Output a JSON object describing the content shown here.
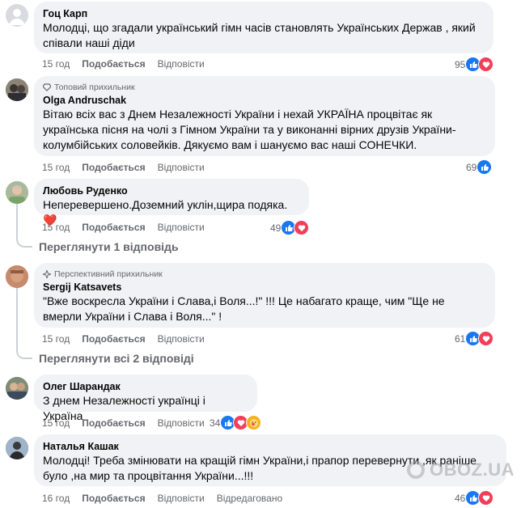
{
  "comments": [
    {
      "author": "Гоц Карп",
      "badge": "",
      "text": "Молодці, що згадали український гімн часів становлять Українських Держав , який співали наші діди",
      "time": "15 год",
      "like_label": "Подобається",
      "reply_label": "Відповісти",
      "edited": "",
      "reactions_count": "95",
      "reactions": [
        "like-icon",
        "love-icon"
      ]
    },
    {
      "author": "Olga Andruschak",
      "badge": "Топовий прихильник",
      "text": "Вітаю всіх вас з Днем Незалежності України і нехай УКРАЇНА процвітає як українська пісня на чолі з Гімном України та у виконанні вірних друзів України-колумбійських соловейків. Дякуємо вам і шануємо вас наші СОНЕЧКИ.",
      "time": "15 год",
      "like_label": "Подобається",
      "reply_label": "Відповісти",
      "edited": "",
      "reactions_count": "69",
      "reactions": [
        "like-icon"
      ]
    },
    {
      "author": "Любовь Руденко",
      "badge": "",
      "text": "Неперевершено.Доземний уклін,щира подяка.❤️",
      "time": "15 год",
      "like_label": "Подобається",
      "reply_label": "Відповісти",
      "edited": "",
      "reactions_count": "49",
      "reactions": [
        "like-icon",
        "love-icon"
      ],
      "view_replies": "Переглянути 1 відповідь"
    },
    {
      "author": "Sergij Katsavets",
      "badge": "Перспективний прихильник",
      "text": "\"Вже воскресла України і Слава,і Воля...!\" !!! Це набагато краще, чим \"Ще не вмерли України і Слава і Воля...\" !",
      "time": "15 год",
      "like_label": "Подобається",
      "reply_label": "Відповісти",
      "edited": "",
      "reactions_count": "61",
      "reactions": [
        "like-icon",
        "love-icon"
      ],
      "view_replies": "Переглянути всі 2 відповіді"
    },
    {
      "author": "Олег Шарандак",
      "badge": "",
      "text": "З днем Незалежності українці і Україна",
      "time": "15 год",
      "like_label": "Подобається",
      "reply_label": "Відповісти",
      "edited": "",
      "reactions_count": "34",
      "reactions": [
        "like-icon",
        "love-icon",
        "care-icon"
      ]
    },
    {
      "author": "Наталья Кашак",
      "badge": "",
      "text": "Молодці! Треба змінювати на кращій гімн України,і прапор перевернути ,як раніше було ,на мир та процвітання України...!!!",
      "time": "16 год",
      "like_label": "Подобається",
      "reply_label": "Відповісти",
      "edited": "Відредаговано",
      "reactions_count": "46",
      "reactions": [
        "like-icon",
        "love-icon"
      ]
    }
  ],
  "watermark": "OBOZ.UA",
  "colors": {
    "bubble": "#f0f2f5",
    "meta": "#65676b",
    "like": "#1877f2",
    "love": "#f33e58",
    "care": "#f7b125"
  }
}
